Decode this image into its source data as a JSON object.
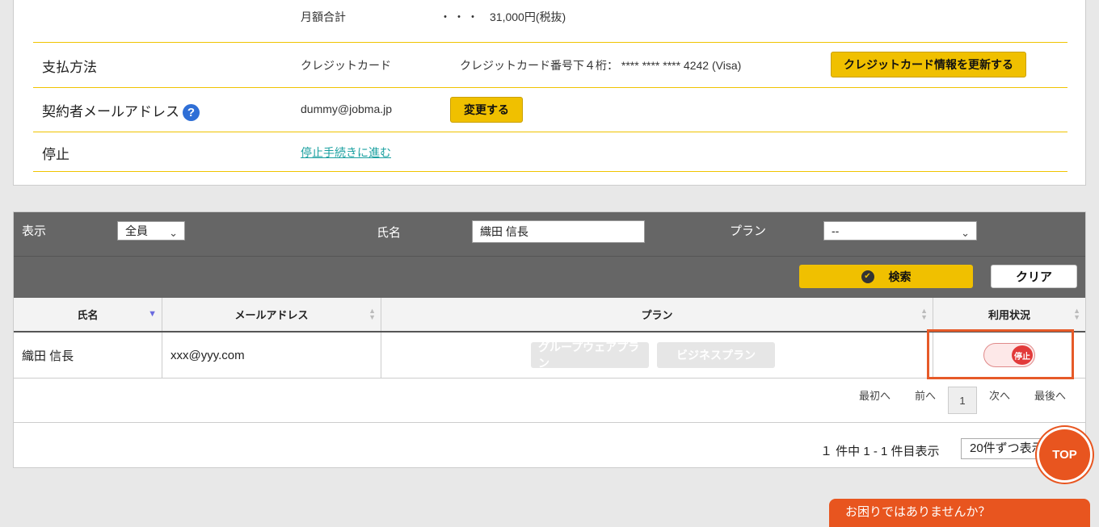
{
  "contract": {
    "monthly_total_label": "月額合計",
    "monthly_total_dots": "・・・",
    "monthly_total_value": "31,000円(税抜)",
    "payment_label": "支払方法",
    "payment_method": "クレジットカード",
    "card_info": "クレジットカード番号下４桁：  **** **** **** 4242 (Visa)",
    "update_card_button": "クレジットカード情報を更新する",
    "email_label": "契約者メールアドレス",
    "help_icon": "?",
    "email_value": "dummy@jobma.jp",
    "change_button": "変更する",
    "stop_label": "停止",
    "stop_link": "停止手続きに進む"
  },
  "filter": {
    "display_label": "表示",
    "display_value": "全員",
    "name_label": "氏名",
    "name_value": "織田 信長",
    "plan_label": "プラン",
    "plan_value": "--",
    "search_button": "検索",
    "clear_button": "クリア"
  },
  "table": {
    "headers": [
      "氏名",
      "メールアドレス",
      "プラン",
      "利用状況"
    ],
    "rows": [
      {
        "name": "織田 信長",
        "email": "xxx@yyy.com",
        "plans": [
          "グループウェアプラン",
          "ビジネスプラン"
        ],
        "status": "停止"
      }
    ]
  },
  "pagination": {
    "first": "最初へ",
    "prev": "前へ",
    "current": "1",
    "next": "次へ",
    "last": "最後へ",
    "count_text": "１ 件中 1 - 1 件目表示",
    "per_page": "20件ずつ表示"
  },
  "floating": {
    "top_button": "TOP",
    "help_tab": "お困りではありませんか？"
  },
  "colors": {
    "accent_yellow": "#f0c000",
    "accent_orange": "#e8551f",
    "filter_bg": "#666666"
  }
}
